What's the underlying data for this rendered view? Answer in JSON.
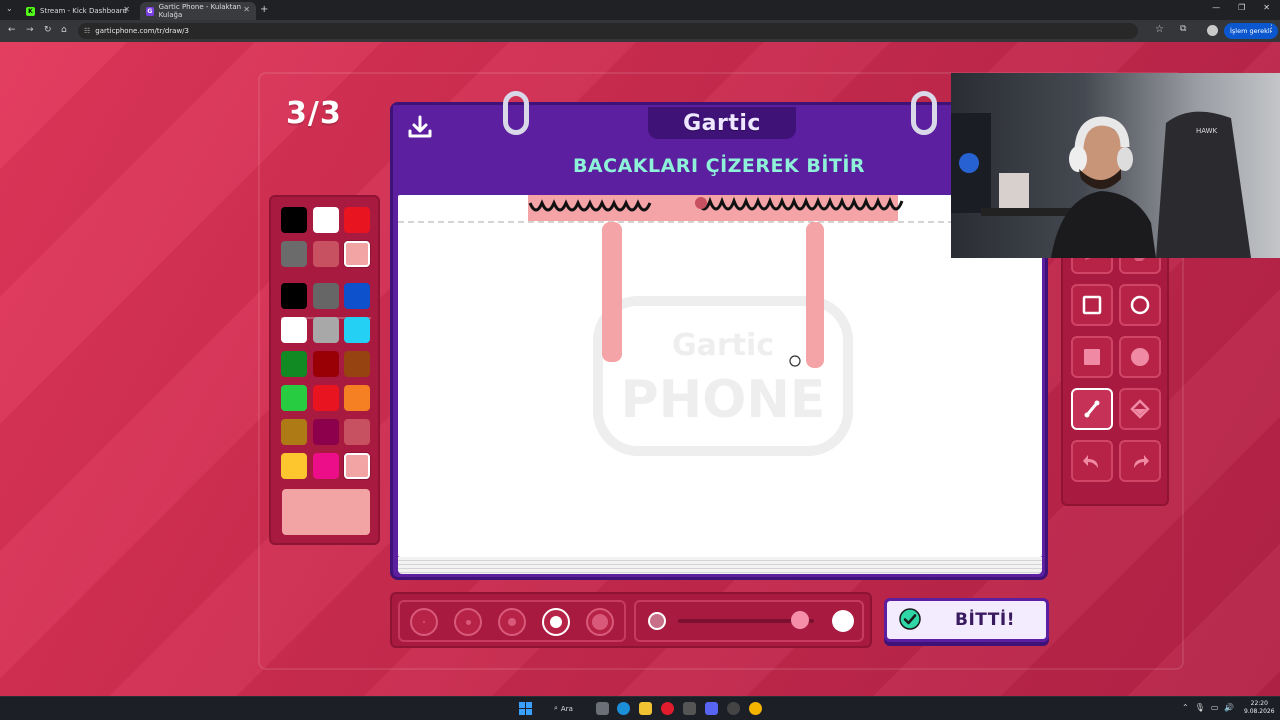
{
  "browser": {
    "tabs": [
      {
        "title": "Stream - Kick Dashboard",
        "favicon": "kick-icon",
        "active": false
      },
      {
        "title": "Gartic Phone - Kulaktan Kulağa",
        "favicon": "gartic-icon",
        "active": true
      }
    ],
    "url": "garticphone.com/tr/draw/3",
    "action_label": "İşlem gerekli"
  },
  "game": {
    "round_counter": "3/3",
    "logo": "Gartic",
    "instruction": "BACAKLARI ÇİZEREK BİTİR",
    "watermark_top": "Gartic",
    "watermark_bottom": "PHONE",
    "done_label": "BİTTİ!",
    "palette": {
      "top_colors": [
        "#000000",
        "#ffffff",
        "#e8141f",
        "#6b6b6b",
        "#c75161",
        "#f2a3a4"
      ],
      "main_colors": [
        "#000000",
        "#666666",
        "#0d51cc",
        "#ffffff",
        "#a8a8a8",
        "#25d0f5",
        "#128a24",
        "#990006",
        "#964311",
        "#28cc40",
        "#e8141f",
        "#f57f23",
        "#ad7a16",
        "#8c004c",
        "#c75161",
        "#fec62e",
        "#ec0d88",
        "#f2a3a4"
      ],
      "selected_color": "#f2a3a4",
      "current_color": "#f2a3a4"
    },
    "tools": [
      {
        "name": "pencil-tool-icon"
      },
      {
        "name": "eraser-tool-icon"
      },
      {
        "name": "rectangle-outline-tool-icon"
      },
      {
        "name": "circle-outline-tool-icon"
      },
      {
        "name": "rectangle-filled-tool-icon"
      },
      {
        "name": "circle-filled-tool-icon"
      },
      {
        "name": "line-tool-icon",
        "selected": true
      },
      {
        "name": "fill-bucket-tool-icon"
      },
      {
        "name": "undo-icon"
      },
      {
        "name": "redo-icon"
      }
    ],
    "brush_sizes": {
      "count": 5,
      "selected_index": 3
    },
    "opacity": 0.9
  },
  "taskbar": {
    "search_label": "Ara",
    "time": "22:20",
    "date": "9.08.2026"
  }
}
